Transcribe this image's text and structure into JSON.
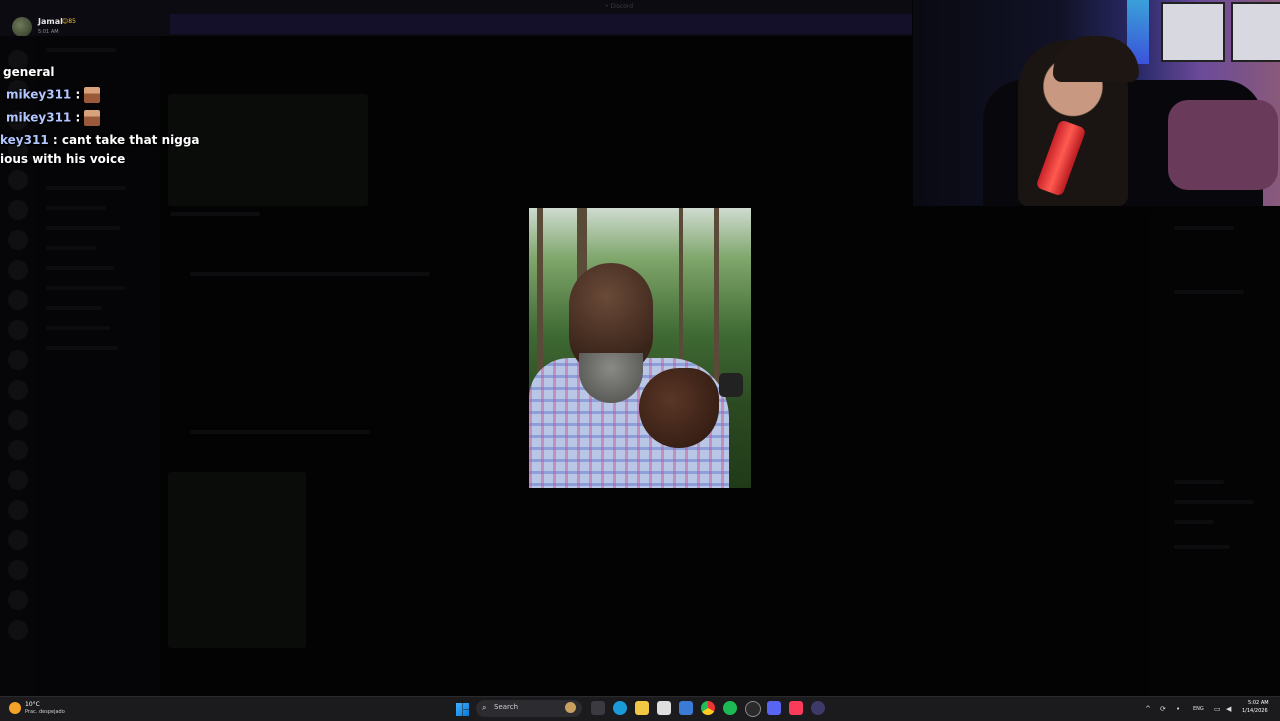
{
  "top_bar": {
    "user_name": "Jamal",
    "user_badge": "😊85",
    "user_time": "5:01 AM",
    "window_title": "• Discord"
  },
  "chat_overlay": {
    "lines": [
      {
        "user": "",
        "text": "general"
      },
      {
        "user": "mikey311",
        "separator": " :",
        "emote": "face-emote"
      },
      {
        "user": "mikey311",
        "separator": " :",
        "emote": "face-emote"
      },
      {
        "user": "key311",
        "separator": " : ",
        "text": "cant take that nigga"
      },
      {
        "user": "",
        "text": "ious with his voice"
      }
    ]
  },
  "photo": {
    "description_icon": "portrait-photo"
  },
  "webcam": {
    "icon": "webcam-feed"
  },
  "taskbar": {
    "weather_temp": "10°C",
    "weather_condition": "Prac. despejado",
    "search_label": "Search",
    "language": "ENG",
    "clock_time": "5:02 AM",
    "clock_date": "1/14/2026",
    "accent": "#0a78d8"
  }
}
